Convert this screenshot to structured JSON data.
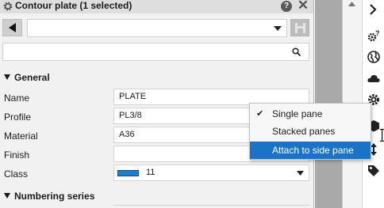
{
  "panel": {
    "title": "Contour plate (1 selected)",
    "title_icon": "gear-icon",
    "help_label": "?",
    "close_label": "✕"
  },
  "toolbar": {
    "selector_value": "",
    "search_value": "",
    "search_icon": "search-icon"
  },
  "sections": {
    "general": "General",
    "numbering": "Numbering series"
  },
  "properties": [
    {
      "label": "Name",
      "value": "PLATE"
    },
    {
      "label": "Profile",
      "value": "PL3/8"
    },
    {
      "label": "Material",
      "value": "A36"
    },
    {
      "label": "Finish",
      "value": ""
    },
    {
      "label": "Class",
      "value": "11",
      "swatch_color": "#1d7fcc"
    }
  ],
  "menu": {
    "items": [
      {
        "label": "Single pane",
        "checked": true
      },
      {
        "label": "Stacked panes",
        "checked": false
      },
      {
        "label": "Attach to side pane",
        "checked": false,
        "highlighted": true
      }
    ],
    "check_mark": "✔",
    "highlight_color": "#1a73c5"
  },
  "side_toolbar": {
    "icons": [
      "chevron-right-icon",
      "gear-question-icon",
      "globe-icon",
      "cloud-icon",
      "gear-icon",
      "cube-icon",
      "arrows-icon",
      "tag-icon"
    ]
  }
}
